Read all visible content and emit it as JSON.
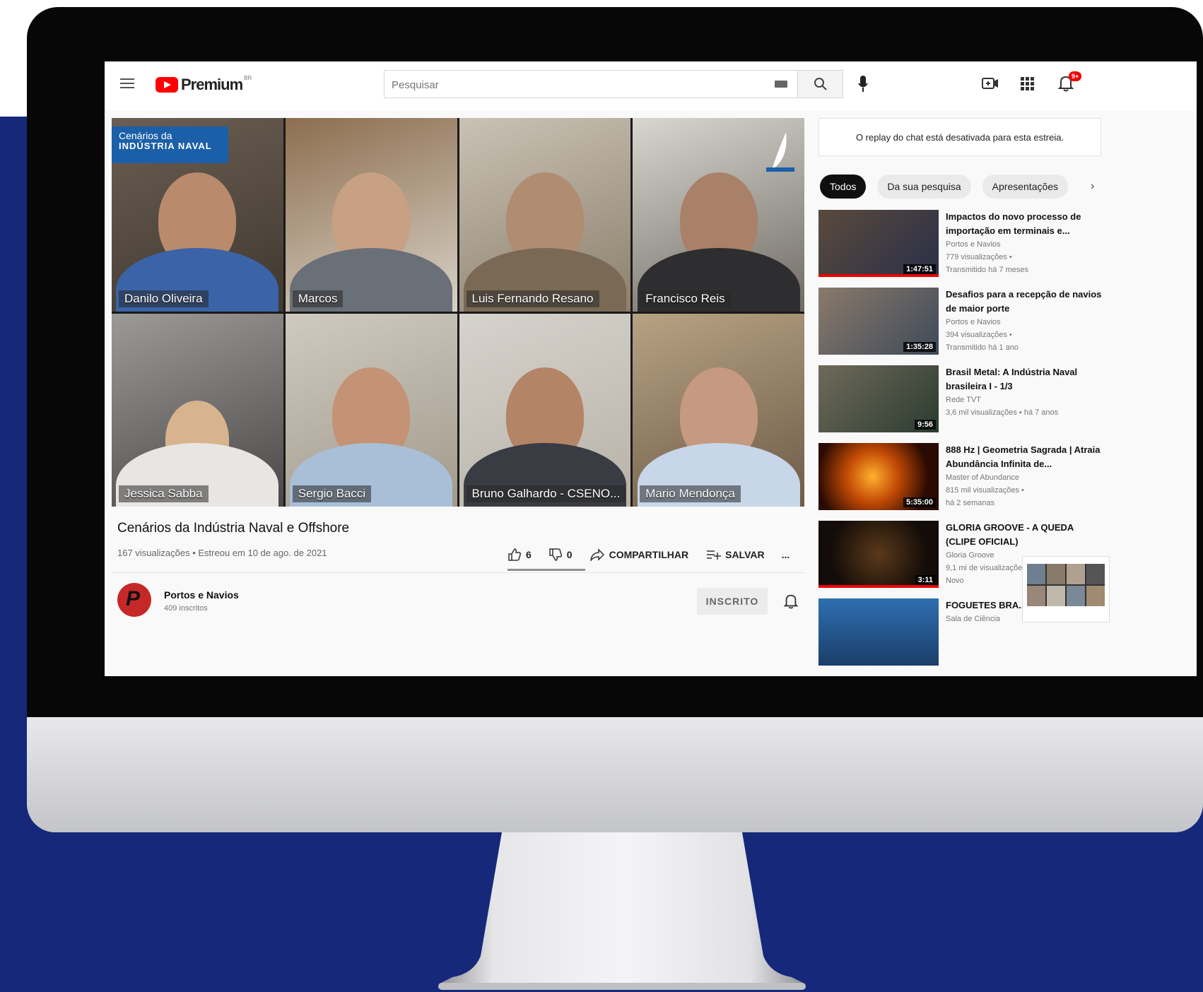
{
  "header": {
    "brand_label": "Premium",
    "brand_sup": "BR",
    "search_placeholder": "Pesquisar",
    "notification_count": "9+"
  },
  "video": {
    "branding_line1": "Cenários da",
    "branding_line2": "INDÚSTRIA NAVAL",
    "participants": [
      {
        "name": "Danilo Oliveira"
      },
      {
        "name": "Marcos"
      },
      {
        "name": "Luis Fernando Resano"
      },
      {
        "name": "Francisco Reis"
      },
      {
        "name": "Jessica Sabba"
      },
      {
        "name": "Sergio Bacci"
      },
      {
        "name": "Bruno Galhardo - CSENO..."
      },
      {
        "name": "Mario Mendonça"
      }
    ],
    "title": "Cenários da Indústria Naval e Offshore",
    "meta": "167 visualizações • Estreou em 10 de ago. de 2021",
    "likes": "6",
    "dislikes": "0",
    "share_label": "COMPARTILHAR",
    "save_label": "SALVAR",
    "more_label": "..."
  },
  "channel": {
    "name": "Portos e Navios",
    "subscribers": "409 inscritos",
    "subscribe_label": "INSCRITO"
  },
  "sidebar": {
    "chat_notice": "O replay do chat está desativada para esta estreia.",
    "chips": [
      "Todos",
      "Da sua pesquisa",
      "Apresentações"
    ],
    "recommendations": [
      {
        "title": "Impactos do novo processo de importação em terminais e...",
        "channel": "Portos e Navios",
        "views": "779 visualizações •",
        "age": "Transmitido há 7 meses",
        "duration": "1:47:51",
        "progress": 1.0
      },
      {
        "title": "Desafios para a recepção de navios de maior porte",
        "channel": "Portos e Navios",
        "views": "394 visualizações •",
        "age": "Transmitido há 1 ano",
        "duration": "1:35:28",
        "progress": 0.0
      },
      {
        "title": "Brasil Metal: A Indústria Naval brasileira I - 1/3",
        "channel": "Rede TVT",
        "views": "3,6 mil visualizações • há 7 anos",
        "age": "",
        "duration": "9:56",
        "progress": 0.0
      },
      {
        "title": "888 Hz | Geometria Sagrada | Atraia Abundância Infinita de...",
        "channel": "Master of Abundance",
        "views": "815 mil visualizações •",
        "age": "há 2 semanas",
        "duration": "5:35:00",
        "progress": 0.0
      },
      {
        "title": "GLORIA GROOVE - A QUEDA (CLIPE OFICIAL)",
        "channel": "Gloria Groove",
        "views": "9,1 mi de visualizações",
        "age": "Novo",
        "duration": "3:11",
        "progress": 1.0
      },
      {
        "title": "FOGUETES BRA... que já fizemos ...",
        "channel": "Sala de Ciência",
        "views": "",
        "age": "",
        "duration": "",
        "progress": 0.0
      }
    ]
  },
  "colors": {
    "backdrop": "#15287a",
    "youtube_red": "#ff0000",
    "brand_blue": "#1b5fa8"
  }
}
